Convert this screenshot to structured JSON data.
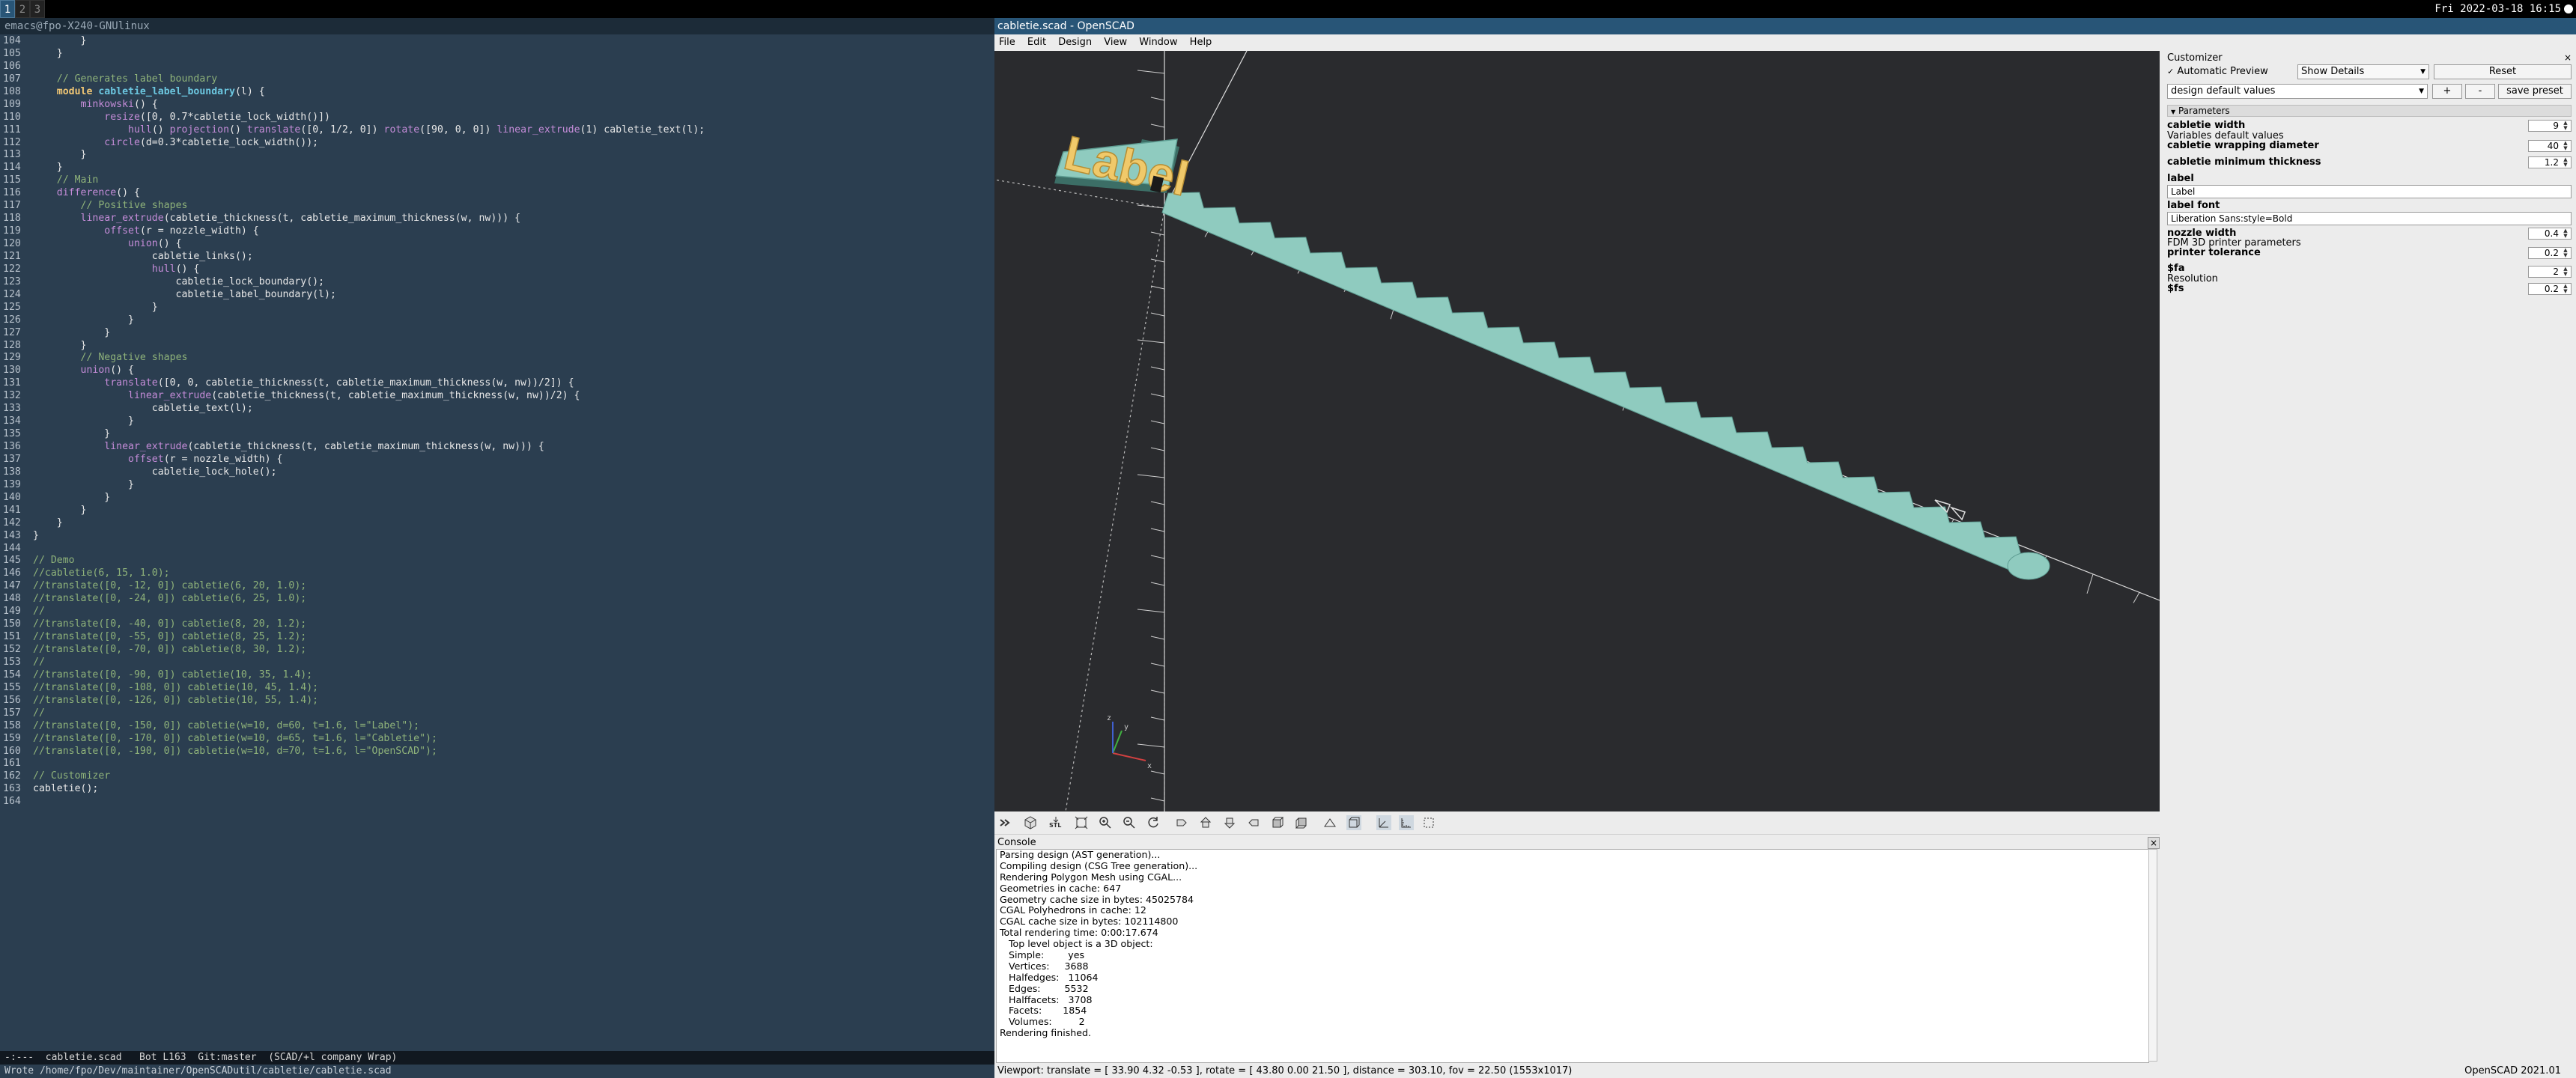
{
  "topbar": {
    "workspaces": [
      "1",
      "2",
      "3"
    ],
    "clock": "Fri 2022-03-18 16:15"
  },
  "emacs": {
    "title": "emacs@fpo-X240-GNUlinux",
    "modeline": "-:---  cabletie.scad   Bot L163  Git:master  (SCAD/+l company Wrap)",
    "modeline_file": "cabletie.scad",
    "echo": "Wrote /home/fpo/Dev/maintainer/OpenSCADutil/cabletie/cabletie.scad",
    "lines": [
      {
        "n": "104",
        "t": "        }"
      },
      {
        "n": "105",
        "t": "    }"
      },
      {
        "n": "106",
        "t": ""
      },
      {
        "n": "107",
        "t": "    // Generates label boundary"
      },
      {
        "n": "108",
        "t": "    module cabletie_label_boundary(l) {"
      },
      {
        "n": "109",
        "t": "        minkowski() {"
      },
      {
        "n": "110",
        "t": "            resize([0, 0.7*cabletie_lock_width()])"
      },
      {
        "n": "111",
        "t": "                hull() projection() translate([0, 1/2, 0]) rotate([90, 0, 0]) linear_extrude(1) cabletie_text(l);"
      },
      {
        "n": "112",
        "t": "            circle(d=0.3*cabletie_lock_width());"
      },
      {
        "n": "113",
        "t": "        }"
      },
      {
        "n": "114",
        "t": "    }"
      },
      {
        "n": "115",
        "t": "    // Main"
      },
      {
        "n": "116",
        "t": "    difference() {"
      },
      {
        "n": "117",
        "t": "        // Positive shapes"
      },
      {
        "n": "118",
        "t": "        linear_extrude(cabletie_thickness(t, cabletie_maximum_thickness(w, nw))) {"
      },
      {
        "n": "119",
        "t": "            offset(r = nozzle_width) {"
      },
      {
        "n": "120",
        "t": "                union() {"
      },
      {
        "n": "121",
        "t": "                    cabletie_links();"
      },
      {
        "n": "122",
        "t": "                    hull() {"
      },
      {
        "n": "123",
        "t": "                        cabletie_lock_boundary();"
      },
      {
        "n": "124",
        "t": "                        cabletie_label_boundary(l);"
      },
      {
        "n": "125",
        "t": "                    }"
      },
      {
        "n": "126",
        "t": "                }"
      },
      {
        "n": "127",
        "t": "            }"
      },
      {
        "n": "128",
        "t": "        }"
      },
      {
        "n": "129",
        "t": "        // Negative shapes"
      },
      {
        "n": "130",
        "t": "        union() {"
      },
      {
        "n": "131",
        "t": "            translate([0, 0, cabletie_thickness(t, cabletie_maximum_thickness(w, nw))/2]) {"
      },
      {
        "n": "132",
        "t": "                linear_extrude(cabletie_thickness(t, cabletie_maximum_thickness(w, nw))/2) {"
      },
      {
        "n": "133",
        "t": "                    cabletie_text(l);"
      },
      {
        "n": "134",
        "t": "                }"
      },
      {
        "n": "135",
        "t": "            }"
      },
      {
        "n": "136",
        "t": "            linear_extrude(cabletie_thickness(t, cabletie_maximum_thickness(w, nw))) {"
      },
      {
        "n": "137",
        "t": "                offset(r = nozzle_width) {"
      },
      {
        "n": "138",
        "t": "                    cabletie_lock_hole();"
      },
      {
        "n": "139",
        "t": "                }"
      },
      {
        "n": "140",
        "t": "            }"
      },
      {
        "n": "141",
        "t": "        }"
      },
      {
        "n": "142",
        "t": "    }"
      },
      {
        "n": "143",
        "t": "}"
      },
      {
        "n": "144",
        "t": ""
      },
      {
        "n": "145",
        "t": "// Demo"
      },
      {
        "n": "146",
        "t": "//cabletie(6, 15, 1.0);"
      },
      {
        "n": "147",
        "t": "//translate([0, -12, 0]) cabletie(6, 20, 1.0);"
      },
      {
        "n": "148",
        "t": "//translate([0, -24, 0]) cabletie(6, 25, 1.0);"
      },
      {
        "n": "149",
        "t": "//"
      },
      {
        "n": "150",
        "t": "//translate([0, -40, 0]) cabletie(8, 20, 1.2);"
      },
      {
        "n": "151",
        "t": "//translate([0, -55, 0]) cabletie(8, 25, 1.2);"
      },
      {
        "n": "152",
        "t": "//translate([0, -70, 0]) cabletie(8, 30, 1.2);"
      },
      {
        "n": "153",
        "t": "//"
      },
      {
        "n": "154",
        "t": "//translate([0, -90, 0]) cabletie(10, 35, 1.4);"
      },
      {
        "n": "155",
        "t": "//translate([0, -108, 0]) cabletie(10, 45, 1.4);"
      },
      {
        "n": "156",
        "t": "//translate([0, -126, 0]) cabletie(10, 55, 1.4);"
      },
      {
        "n": "157",
        "t": "//"
      },
      {
        "n": "158",
        "t": "//translate([0, -150, 0]) cabletie(w=10, d=60, t=1.6, l=\"Label\");"
      },
      {
        "n": "159",
        "t": "//translate([0, -170, 0]) cabletie(w=10, d=65, t=1.6, l=\"Cabletie\");"
      },
      {
        "n": "160",
        "t": "//translate([0, -190, 0]) cabletie(w=10, d=70, t=1.6, l=\"OpenSCAD\");"
      },
      {
        "n": "161",
        "t": ""
      },
      {
        "n": "162",
        "t": "// Customizer"
      },
      {
        "n": "163",
        "t": "cabletie();"
      },
      {
        "n": "164",
        "t": ""
      }
    ]
  },
  "openscad": {
    "title": "cabletie.scad - OpenSCAD",
    "menu": [
      "File",
      "Edit",
      "Design",
      "View",
      "Window",
      "Help"
    ],
    "model_text": "Label",
    "console_title": "Console",
    "console_lines": [
      "Parsing design (AST generation)...",
      "Compiling design (CSG Tree generation)...",
      "Rendering Polygon Mesh using CGAL...",
      "Geometries in cache: 647",
      "Geometry cache size in bytes: 45025784",
      "CGAL Polyhedrons in cache: 12",
      "CGAL cache size in bytes: 102114800",
      "Total rendering time: 0:00:17.674",
      "   Top level object is a 3D object:",
      "   Simple:        yes",
      "   Vertices:     3688",
      "   Halfedges:   11064",
      "   Edges:        5532",
      "   Halffacets:   3708",
      "   Facets:       1854",
      "   Volumes:         2",
      "Rendering finished."
    ],
    "status_viewport": "Viewport: translate = [ 33.90 4.32 -0.53 ], rotate = [ 43.80 0.00 21.50 ], distance = 303.10, fov = 22.50 (1553x1017)",
    "status_version": "OpenSCAD 2021.01"
  },
  "customizer": {
    "title": "Customizer",
    "auto_preview_label": "Automatic Preview",
    "auto_preview_checked": true,
    "details_select": "Show Details",
    "reset_label": "Reset",
    "preset_select": "design default values",
    "plus_label": "+",
    "minus_label": "-",
    "save_preset_label": "save preset",
    "params_header": "Parameters",
    "params": {
      "width_label": "cabletie width",
      "width_value": "9",
      "group1_desc": "Variables default values",
      "diameter_label": "cabletie wrapping diameter",
      "diameter_value": "40",
      "min_thickness_label": "cabletie minimum thickness",
      "min_thickness_value": "1.2",
      "label_label": "label",
      "label_value": "Label",
      "font_label": "label font",
      "font_value": "Liberation Sans:style=Bold",
      "nozzle_label": "nozzle width",
      "nozzle_value": "0.4",
      "group2_desc": "FDM 3D printer parameters",
      "tolerance_label": "printer tolerance",
      "tolerance_value": "0.2",
      "fa_label": "$fa",
      "fa_value": "2",
      "group3_desc": "Resolution",
      "fs_label": "$fs",
      "fs_value": "0.2"
    }
  },
  "colors": {
    "model_fill": "#8fcbbf",
    "model_edge": "#5f9e93",
    "model_shadow": "#3c6e66",
    "label_text": "#f0c96a",
    "viewport_bg": "#2a2b2e",
    "emacs_bg": "#2b3e50"
  }
}
